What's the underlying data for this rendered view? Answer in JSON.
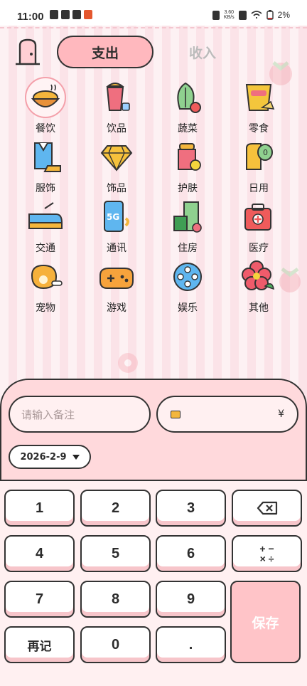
{
  "status": {
    "time": "11:00",
    "speed_top": "3.60",
    "speed_bottom": "KB/s",
    "battery": "2%"
  },
  "tabs": {
    "expense": "支出",
    "income": "收入"
  },
  "categories": [
    {
      "label": "餐饮",
      "icon": "food-bowl-icon",
      "selected": true
    },
    {
      "label": "饮品",
      "icon": "drink-cup-icon"
    },
    {
      "label": "蔬菜",
      "icon": "vegetable-icon"
    },
    {
      "label": "零食",
      "icon": "snack-bag-icon"
    },
    {
      "label": "服饰",
      "icon": "clothes-icon"
    },
    {
      "label": "饰品",
      "icon": "diamond-icon"
    },
    {
      "label": "护肤",
      "icon": "skincare-icon"
    },
    {
      "label": "日用",
      "icon": "tissue-roll-icon"
    },
    {
      "label": "交通",
      "icon": "train-icon"
    },
    {
      "label": "通讯",
      "icon": "phone-5g-icon"
    },
    {
      "label": "住房",
      "icon": "building-icon"
    },
    {
      "label": "医疗",
      "icon": "medical-kit-icon"
    },
    {
      "label": "宠物",
      "icon": "paw-icon"
    },
    {
      "label": "游戏",
      "icon": "gamepad-icon"
    },
    {
      "label": "娱乐",
      "icon": "film-reel-icon"
    },
    {
      "label": "其他",
      "icon": "flower-icon"
    }
  ],
  "form": {
    "note_placeholder": "请输入备注",
    "currency": "¥",
    "date": "2026-2-9"
  },
  "keypad": {
    "k1": "1",
    "k2": "2",
    "k3": "3",
    "k4": "4",
    "k5": "5",
    "k6": "6",
    "k7": "7",
    "k8": "8",
    "k9": "9",
    "k0": "0",
    "dot": ".",
    "again": "再记",
    "save": "保存",
    "ops_top": "+ −",
    "ops_bottom": "× ÷"
  },
  "colors": {
    "accent": "#ffb8be",
    "panel": "#ffd9dc",
    "outline": "#333333"
  }
}
